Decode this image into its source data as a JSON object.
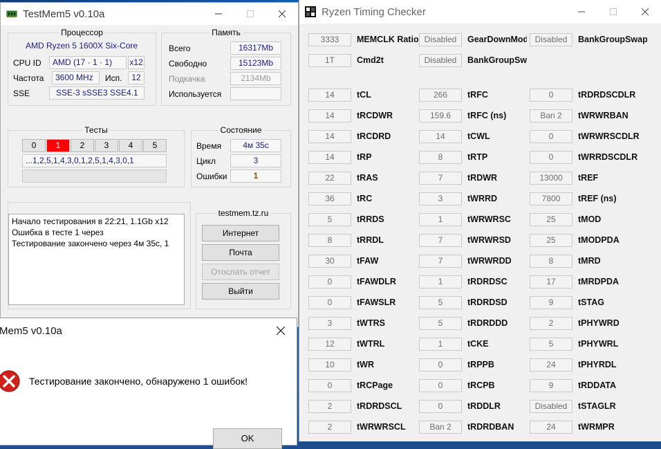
{
  "testmem": {
    "title": "TestMem5 v0.10a",
    "cpu_group": {
      "title": "Процессор",
      "cpu_name": "AMD Ryzen 5 1600X Six-Core",
      "cpuid_label": "CPU ID",
      "cpuid_value": "AMD  (17 · 1 · 1)",
      "cpuid_threads": "x12",
      "freq_label": "Частота",
      "freq_value": "3600 MHz",
      "use_label": "Исп.",
      "use_value": "12",
      "sse_label": "SSE",
      "sse_value": "SSE-3 sSSE3 SSE4.1"
    },
    "mem_group": {
      "title": "Память",
      "total_label": "Всего",
      "total_value": "16317Mb",
      "free_label": "Свободно",
      "free_value": "15123Mb",
      "swap_label": "Подкачка",
      "swap_value": "2134Mb",
      "used_label": "Используется",
      "used_value": ""
    },
    "tests_group": {
      "title": "Тесты",
      "cells": [
        "0",
        "1",
        "2",
        "3",
        "4",
        "5"
      ],
      "sequence": "...1,2,5,1,4,3,0,1,2,5,1,4,3,0,1"
    },
    "state_group": {
      "title": "Состояние",
      "time_label": "Время",
      "time_value": "4м 35с",
      "cycle_label": "Цикл",
      "cycle_value": "3",
      "errors_label": "Ошибки",
      "errors_value": "1"
    },
    "log_lines": [
      "Начало тестирования в 22:21, 1.1Gb x12",
      "Ошибка в тесте 1 через",
      "Тестирование закончено через 4м 35с, 1"
    ],
    "site_group": {
      "title": "testmem.tz.ru",
      "internet": "Интернет",
      "mail": "Почта",
      "send_report": "Отослать отчет",
      "exit": "Выйти"
    }
  },
  "dialog": {
    "title": "Mem5 v0.10a",
    "message": "Тестирование закончено, обнаружено 1 ошибок!",
    "ok": "OK"
  },
  "rtc": {
    "title": "Ryzen Timing Checker",
    "top": [
      {
        "value": "3333",
        "label": "MEMCLK Ratio"
      },
      {
        "value": "Disabled",
        "label": "GearDownMode"
      },
      {
        "value": "Disabled",
        "label": "BankGroupSwap"
      },
      {
        "value": "1T",
        "label": "Cmd2t"
      },
      {
        "value": "Disabled",
        "label": "BankGroupSwapAlt"
      }
    ],
    "col1": [
      {
        "value": "14",
        "label": "tCL"
      },
      {
        "value": "14",
        "label": "tRCDWR"
      },
      {
        "value": "14",
        "label": "tRCDRD"
      },
      {
        "value": "14",
        "label": "tRP"
      },
      {
        "value": "22",
        "label": "tRAS"
      },
      {
        "value": "36",
        "label": "tRC"
      },
      {
        "value": "5",
        "label": "tRRDS"
      },
      {
        "value": "8",
        "label": "tRRDL"
      },
      {
        "value": "30",
        "label": "tFAW"
      },
      {
        "value": "0",
        "label": "tFAWDLR"
      },
      {
        "value": "0",
        "label": "tFAWSLR"
      },
      {
        "value": "3",
        "label": "tWTRS"
      },
      {
        "value": "12",
        "label": "tWTRL"
      },
      {
        "value": "10",
        "label": "tWR"
      },
      {
        "value": "0",
        "label": "tRCPage"
      },
      {
        "value": "2",
        "label": "tRDRDSCL"
      },
      {
        "value": "2",
        "label": "tWRWRSCL"
      }
    ],
    "col2": [
      {
        "value": "266",
        "label": "tRFC"
      },
      {
        "value": "159.6",
        "label": "tRFC (ns)"
      },
      {
        "value": "14",
        "label": "tCWL"
      },
      {
        "value": "8",
        "label": "tRTP"
      },
      {
        "value": "7",
        "label": "tRDWR"
      },
      {
        "value": "3",
        "label": "tWRRD"
      },
      {
        "value": "1",
        "label": "tWRWRSC"
      },
      {
        "value": "7",
        "label": "tWRWRSD"
      },
      {
        "value": "7",
        "label": "tWRWRDD"
      },
      {
        "value": "1",
        "label": "tRDRDSC"
      },
      {
        "value": "5",
        "label": "tRDRDSD"
      },
      {
        "value": "5",
        "label": "tRDRDDD"
      },
      {
        "value": "1",
        "label": "tCKE"
      },
      {
        "value": "0",
        "label": "tRPPB"
      },
      {
        "value": "0",
        "label": "tRCPB"
      },
      {
        "value": "0",
        "label": "tRDDLR"
      },
      {
        "value": "Ban 2",
        "label": "tRDRDBAN"
      }
    ],
    "col3": [
      {
        "value": "0",
        "label": "tRDRDSCDLR"
      },
      {
        "value": "Ban 2",
        "label": "tWRWRBAN"
      },
      {
        "value": "0",
        "label": "tWRWRSCDLR"
      },
      {
        "value": "0",
        "label": "tWRRDSCDLR"
      },
      {
        "value": "13000",
        "label": "tREF"
      },
      {
        "value": "7800",
        "label": "tREF (ns)"
      },
      {
        "value": "25",
        "label": "tMOD"
      },
      {
        "value": "25",
        "label": "tMODPDA"
      },
      {
        "value": "8",
        "label": "tMRD"
      },
      {
        "value": "17",
        "label": "tMRDPDA"
      },
      {
        "value": "9",
        "label": "tSTAG"
      },
      {
        "value": "2",
        "label": "tPHYWRD"
      },
      {
        "value": "5",
        "label": "tPHYWRL"
      },
      {
        "value": "24",
        "label": "tPHYRDL"
      },
      {
        "value": "9",
        "label": "tRDDATA"
      },
      {
        "value": "Disabled",
        "label": "tSTAGLR"
      },
      {
        "value": "24",
        "label": "tWRMPR"
      }
    ]
  }
}
